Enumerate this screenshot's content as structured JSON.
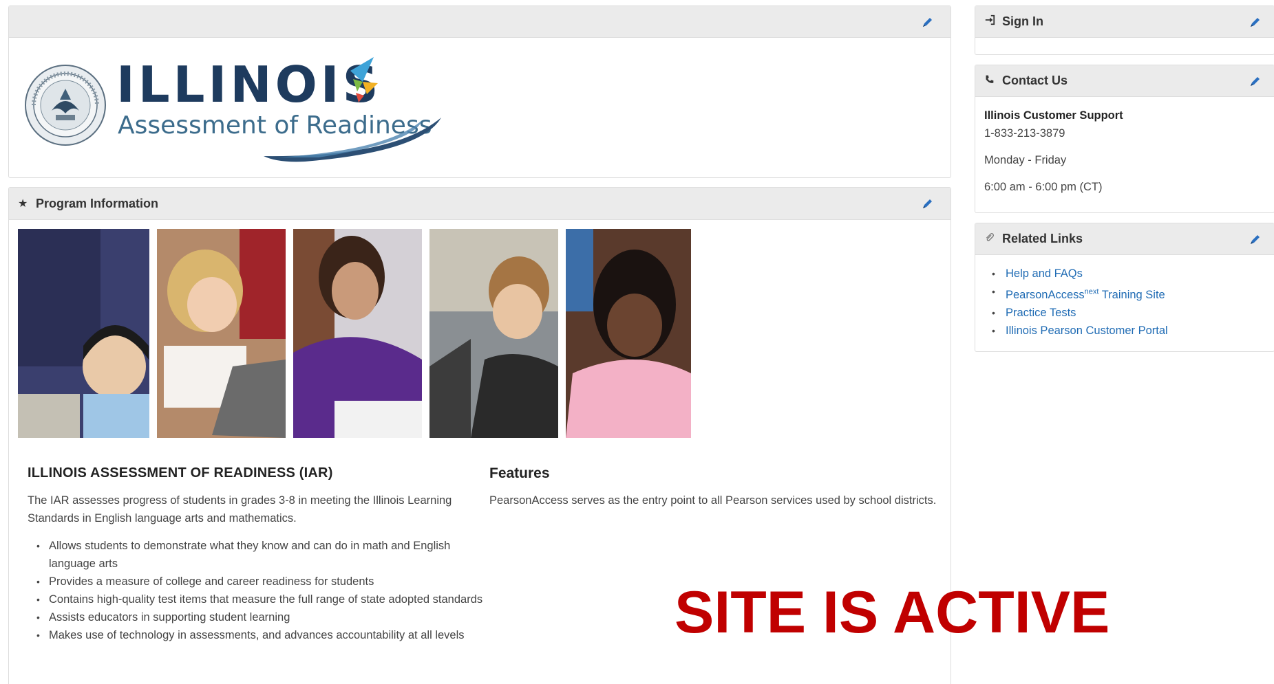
{
  "colors": {
    "panel_header_bg": "#ebebeb",
    "link": "#1f6bb4",
    "pencil_icon": "#2a6fc0",
    "overlay_text": "#c00000",
    "logo_navy": "#1e3b5e",
    "logo_subtitle": "#3c6c8c"
  },
  "logo_panel": {
    "logo_word": "ILLINOIS",
    "logo_subtitle": "Assessment of Readiness",
    "seal_icon": "state-seal-icon",
    "edit_icon": "pencil-icon"
  },
  "program_panel": {
    "header_title": "Program Information",
    "header_icon": "star-icon",
    "edit_icon": "pencil-icon",
    "photos": [
      "student-photo-1",
      "student-photo-2",
      "student-photo-3",
      "student-photo-4",
      "student-photo-5"
    ],
    "iar": {
      "title": "ILLINOIS ASSESSMENT OF READINESS (IAR)",
      "description": "The IAR assesses progress of students in grades 3-8 in meeting the Illinois Learning Standards in English language arts and mathematics.",
      "bullets": [
        "Allows students to demonstrate what they know and can do in math and English language arts",
        "Provides a measure of college and career readiness for students",
        "Contains high-quality test items that measure the full range of state adopted standards",
        "Assists educators in supporting student learning",
        "Makes use of technology in assessments, and advances accountability at all levels"
      ]
    },
    "features": {
      "title": "Features",
      "description": "PearsonAccess serves as the entry point to all Pearson services used by school districts."
    }
  },
  "overlay": {
    "text": "SITE IS ACTIVE"
  },
  "sign_in_panel": {
    "title": "Sign In",
    "icon": "sign-in-icon",
    "edit_icon": "pencil-icon"
  },
  "contact_panel": {
    "title": "Contact Us",
    "icon": "phone-icon",
    "edit_icon": "pencil-icon",
    "org": "Illinois Customer Support",
    "phone": "1-833-213-3879",
    "days": "Monday - Friday",
    "hours": "6:00 am - 6:00 pm (CT)"
  },
  "related_links_panel": {
    "title": "Related Links",
    "icon": "paperclip-icon",
    "edit_icon": "pencil-icon",
    "links": [
      {
        "label": "Help and FAQs"
      },
      {
        "label_prefix": "PearsonAccess",
        "label_sup": "next",
        "label_suffix": " Training Site"
      },
      {
        "label": "Practice Tests"
      },
      {
        "label": "Illinois Pearson Customer Portal"
      }
    ]
  }
}
